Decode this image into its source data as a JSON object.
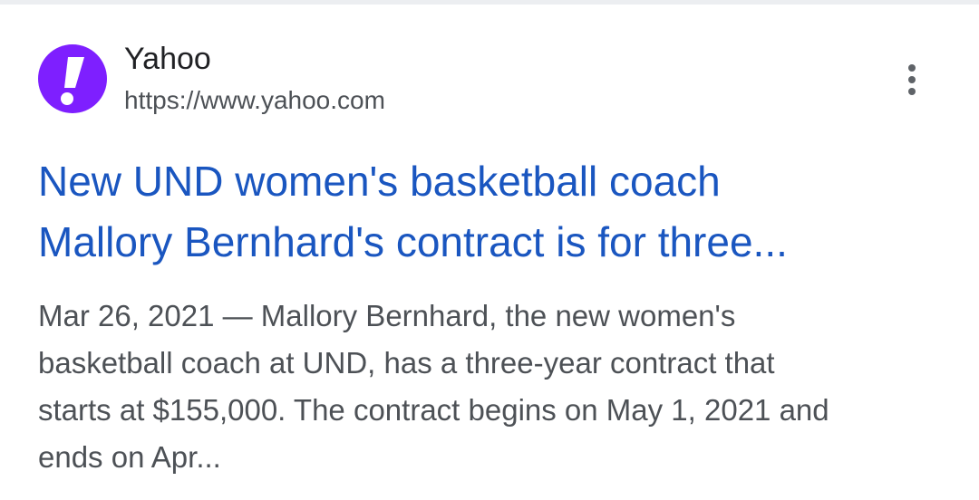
{
  "result": {
    "site_name": "Yahoo",
    "url": "https://www.yahoo.com",
    "favicon_icon": "yahoo-exclamation-logo",
    "favicon_color": "#7e1fff",
    "more_icon": "more-vert-icon",
    "title_lines": [
      "New UND women's basketball coach",
      "Mallory Bernhard's contract is for three..."
    ],
    "snippet_lines": [
      "Mar 26, 2021 — Mallory Bernhard, the new women's",
      "basketball coach at UND, has a three-year contract that",
      "starts at $155,000. The contract begins on May 1, 2021 and",
      "ends on Apr..."
    ]
  },
  "colors": {
    "title_link": "#1a56c0",
    "body_text": "#4d5156",
    "site_name": "#202124"
  }
}
